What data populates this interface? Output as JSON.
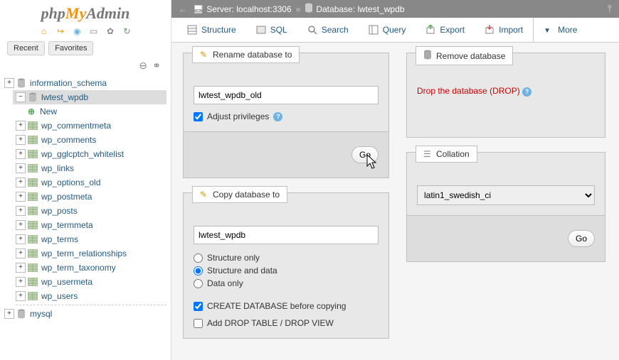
{
  "logo": {
    "php": "php",
    "my": "My",
    "admin": "Admin"
  },
  "sidebar": {
    "recent": "Recent",
    "favorites": "Favorites",
    "tree": [
      {
        "label": "information_schema",
        "level": 0,
        "toggle": "+",
        "icon": "db"
      },
      {
        "label": "lwtest_wpdb",
        "level": 0,
        "toggle": "−",
        "icon": "db",
        "selected": true
      },
      {
        "label": "New",
        "level": 1,
        "icon": "new",
        "new": true
      },
      {
        "label": "wp_commentmeta",
        "level": 1,
        "toggle": "+",
        "icon": "table"
      },
      {
        "label": "wp_comments",
        "level": 1,
        "toggle": "+",
        "icon": "table"
      },
      {
        "label": "wp_gglcptch_whitelist",
        "level": 1,
        "toggle": "+",
        "icon": "table"
      },
      {
        "label": "wp_links",
        "level": 1,
        "toggle": "+",
        "icon": "table"
      },
      {
        "label": "wp_options_old",
        "level": 1,
        "toggle": "+",
        "icon": "table"
      },
      {
        "label": "wp_postmeta",
        "level": 1,
        "toggle": "+",
        "icon": "table"
      },
      {
        "label": "wp_posts",
        "level": 1,
        "toggle": "+",
        "icon": "table"
      },
      {
        "label": "wp_termmeta",
        "level": 1,
        "toggle": "+",
        "icon": "table"
      },
      {
        "label": "wp_terms",
        "level": 1,
        "toggle": "+",
        "icon": "table"
      },
      {
        "label": "wp_term_relationships",
        "level": 1,
        "toggle": "+",
        "icon": "table"
      },
      {
        "label": "wp_term_taxonomy",
        "level": 1,
        "toggle": "+",
        "icon": "table"
      },
      {
        "label": "wp_usermeta",
        "level": 1,
        "toggle": "+",
        "icon": "table"
      },
      {
        "label": "wp_users",
        "level": 1,
        "toggle": "+",
        "icon": "table"
      },
      {
        "label": "mysql",
        "level": 0,
        "toggle": "+",
        "icon": "db",
        "divider_before": true
      }
    ]
  },
  "breadcrumb": {
    "server_label": "Server:",
    "server_value": "localhost:3306",
    "db_label": "Database:",
    "db_value": "lwtest_wpdb",
    "sep": "»"
  },
  "tabs": [
    {
      "label": "Structure",
      "icon": "structure"
    },
    {
      "label": "SQL",
      "icon": "sql"
    },
    {
      "label": "Search",
      "icon": "search"
    },
    {
      "label": "Query",
      "icon": "query"
    },
    {
      "label": "Export",
      "icon": "export"
    },
    {
      "label": "Import",
      "icon": "import"
    },
    {
      "label": "More",
      "icon": "more"
    }
  ],
  "rename": {
    "legend": "Rename database to",
    "value": "lwtest_wpdb_old",
    "adjust_label": "Adjust privileges",
    "go": "Go"
  },
  "remove": {
    "legend": "Remove database",
    "drop_label": "Drop the database (DROP)"
  },
  "copy": {
    "legend": "Copy database to",
    "value": "lwtest_wpdb",
    "opt_structure": "Structure only",
    "opt_structure_data": "Structure and data",
    "opt_data": "Data only",
    "create_label": "CREATE DATABASE before copying",
    "droptable_label": "Add DROP TABLE / DROP VIEW"
  },
  "collation": {
    "legend": "Collation",
    "value": "latin1_swedish_ci",
    "go": "Go"
  }
}
